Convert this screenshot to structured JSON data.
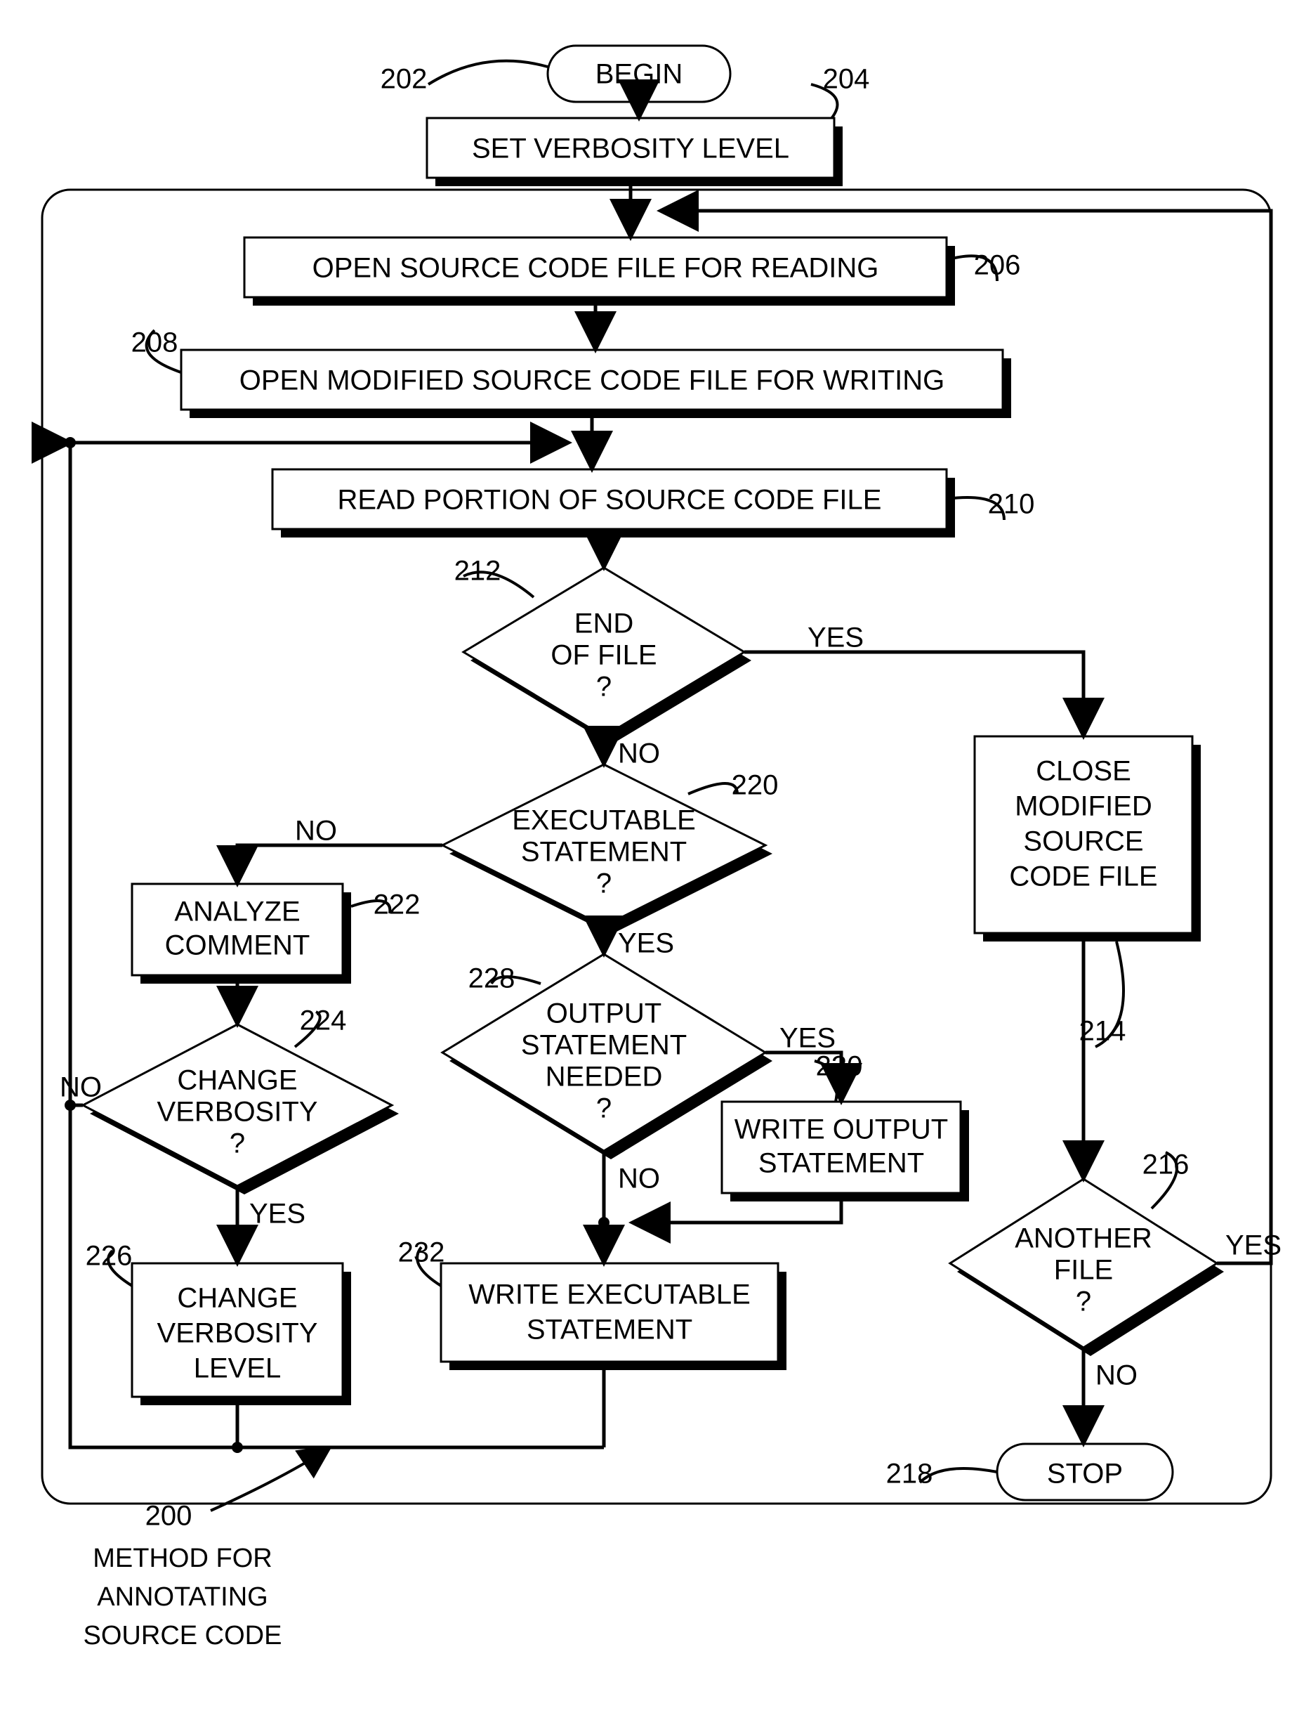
{
  "chart_data": {
    "type": "flowchart",
    "title": "METHOD FOR ANNOTATING SOURCE CODE",
    "title_ref": "200",
    "nodes": [
      {
        "id": "begin",
        "ref": "202",
        "type": "terminal",
        "text": "BEGIN"
      },
      {
        "id": "n204",
        "ref": "204",
        "type": "process",
        "text": "SET VERBOSITY LEVEL"
      },
      {
        "id": "n206",
        "ref": "206",
        "type": "process",
        "text": "OPEN SOURCE CODE FILE FOR READING"
      },
      {
        "id": "n208",
        "ref": "208",
        "type": "process",
        "text": "OPEN MODIFIED SOURCE CODE FILE FOR WRITING"
      },
      {
        "id": "n210",
        "ref": "210",
        "type": "process",
        "text": "READ PORTION OF SOURCE CODE FILE"
      },
      {
        "id": "n212",
        "ref": "212",
        "type": "decision",
        "text": "END OF FILE ?",
        "yes": "n214",
        "no": "n220"
      },
      {
        "id": "n214",
        "ref": "214",
        "type": "process",
        "text": "CLOSE MODIFIED SOURCE CODE FILE"
      },
      {
        "id": "n216",
        "ref": "216",
        "type": "decision",
        "text": "ANOTHER FILE ?",
        "yes": "n206",
        "no": "stop"
      },
      {
        "id": "stop",
        "ref": "218",
        "type": "terminal",
        "text": "STOP"
      },
      {
        "id": "n220",
        "ref": "220",
        "type": "decision",
        "text": "EXECUTABLE STATEMENT ?",
        "yes": "n228",
        "no": "n222"
      },
      {
        "id": "n222",
        "ref": "222",
        "type": "process",
        "text": "ANALYZE COMMENT"
      },
      {
        "id": "n224",
        "ref": "224",
        "type": "decision",
        "text": "CHANGE VERBOSITY ?",
        "yes": "n226",
        "no": "n210"
      },
      {
        "id": "n226",
        "ref": "226",
        "type": "process",
        "text": "CHANGE VERBOSITY LEVEL"
      },
      {
        "id": "n228",
        "ref": "228",
        "type": "decision",
        "text": "OUTPUT STATEMENT NEEDED ?",
        "yes": "n230",
        "no": "n232"
      },
      {
        "id": "n230",
        "ref": "230",
        "type": "process",
        "text": "WRITE OUTPUT STATEMENT"
      },
      {
        "id": "n232",
        "ref": "232",
        "type": "process",
        "text": "WRITE EXECUTABLE STATEMENT"
      }
    ],
    "edges": [
      {
        "from": "begin",
        "to": "n204"
      },
      {
        "from": "n204",
        "to": "n206"
      },
      {
        "from": "n206",
        "to": "n208"
      },
      {
        "from": "n208",
        "to": "n210"
      },
      {
        "from": "n210",
        "to": "n212"
      },
      {
        "from": "n212",
        "to": "n214",
        "label": "YES"
      },
      {
        "from": "n212",
        "to": "n220",
        "label": "NO"
      },
      {
        "from": "n214",
        "to": "n216"
      },
      {
        "from": "n216",
        "to": "n206",
        "label": "YES"
      },
      {
        "from": "n216",
        "to": "stop",
        "label": "NO"
      },
      {
        "from": "n220",
        "to": "n222",
        "label": "NO"
      },
      {
        "from": "n220",
        "to": "n228",
        "label": "YES"
      },
      {
        "from": "n222",
        "to": "n224"
      },
      {
        "from": "n224",
        "to": "n210",
        "label": "NO"
      },
      {
        "from": "n224",
        "to": "n226",
        "label": "YES"
      },
      {
        "from": "n226",
        "to": "n210"
      },
      {
        "from": "n228",
        "to": "n230",
        "label": "YES"
      },
      {
        "from": "n228",
        "to": "n232",
        "label": "NO"
      },
      {
        "from": "n230",
        "to": "n232"
      },
      {
        "from": "n232",
        "to": "n210"
      }
    ]
  },
  "labels": {
    "begin": "BEGIN",
    "stop": "STOP",
    "n204": "SET VERBOSITY LEVEL",
    "n206": "OPEN SOURCE CODE FILE FOR READING",
    "n208": "OPEN MODIFIED SOURCE CODE FILE FOR WRITING",
    "n210": "READ PORTION OF SOURCE CODE FILE",
    "n212a": "END",
    "n212b": "OF FILE",
    "n212c": "?",
    "n214a": "CLOSE",
    "n214b": "MODIFIED",
    "n214c": "SOURCE",
    "n214d": "CODE FILE",
    "n216a": "ANOTHER",
    "n216b": "FILE",
    "n216c": "?",
    "n220a": "EXECUTABLE",
    "n220b": "STATEMENT",
    "n220c": "?",
    "n222a": "ANALYZE",
    "n222b": "COMMENT",
    "n224a": "CHANGE",
    "n224b": "VERBOSITY",
    "n224c": "?",
    "n226a": "CHANGE",
    "n226b": "VERBOSITY",
    "n226c": "LEVEL",
    "n228a": "OUTPUT",
    "n228b": "STATEMENT",
    "n228c": "NEEDED",
    "n228d": "?",
    "n230a": "WRITE OUTPUT",
    "n230b": "STATEMENT",
    "n232a": "WRITE EXECUTABLE",
    "n232b": "STATEMENT",
    "yes": "YES",
    "no": "NO",
    "r200": "200",
    "r202": "202",
    "r204": "204",
    "r206": "206",
    "r208": "208",
    "r210": "210",
    "r212": "212",
    "r214": "214",
    "r216": "216",
    "r218": "218",
    "r220": "220",
    "r222": "222",
    "r224": "224",
    "r226": "226",
    "r228": "228",
    "r230": "230",
    "r232": "232",
    "title1": "METHOD FOR",
    "title2": "ANNOTATING",
    "title3": "SOURCE CODE"
  }
}
